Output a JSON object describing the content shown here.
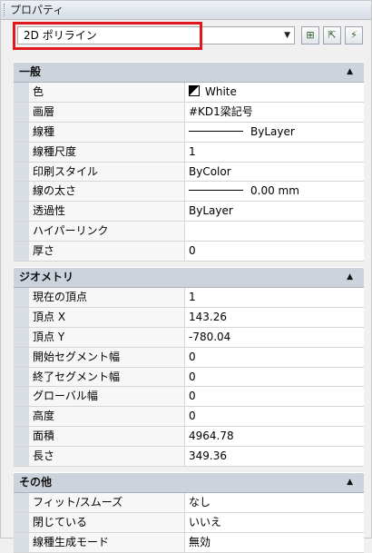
{
  "panel": {
    "title": "プロパティ"
  },
  "selector": {
    "value": "2D ポリライン"
  },
  "categories": [
    {
      "label": "一般",
      "rows": [
        {
          "name": "色",
          "value": "White",
          "kind": "color"
        },
        {
          "name": "画層",
          "value": "#KD1梁記号"
        },
        {
          "name": "線種",
          "value": "ByLayer",
          "kind": "line"
        },
        {
          "name": "線種尺度",
          "value": "1"
        },
        {
          "name": "印刷スタイル",
          "value": "ByColor"
        },
        {
          "name": "線の太さ",
          "value": "0.00 mm",
          "kind": "line"
        },
        {
          "name": "透過性",
          "value": "ByLayer"
        },
        {
          "name": "ハイパーリンク",
          "value": ""
        },
        {
          "name": "厚さ",
          "value": "0"
        }
      ]
    },
    {
      "label": "ジオメトリ",
      "rows": [
        {
          "name": "現在の頂点",
          "value": "1"
        },
        {
          "name": "頂点 X",
          "value": "143.26"
        },
        {
          "name": "頂点 Y",
          "value": "-780.04"
        },
        {
          "name": "開始セグメント幅",
          "value": "0"
        },
        {
          "name": "終了セグメント幅",
          "value": "0"
        },
        {
          "name": "グローバル幅",
          "value": "0"
        },
        {
          "name": "高度",
          "value": "0"
        },
        {
          "name": "面積",
          "value": "4964.78"
        },
        {
          "name": "長さ",
          "value": "349.36"
        }
      ]
    },
    {
      "label": "その他",
      "rows": [
        {
          "name": "フィット/スムーズ",
          "value": "なし"
        },
        {
          "name": "閉じている",
          "value": "いいえ"
        },
        {
          "name": "線種生成モード",
          "value": "無効"
        }
      ]
    }
  ]
}
